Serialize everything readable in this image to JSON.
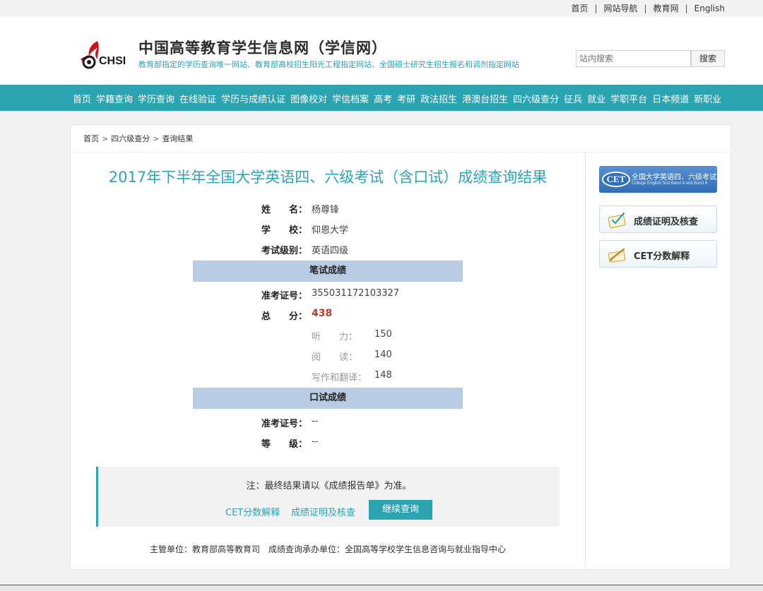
{
  "topnav": {
    "items": [
      "首页",
      "网站导航",
      "教育网",
      "English"
    ],
    "separator": "|"
  },
  "header": {
    "logo_text": "CHSI",
    "title": "中国高等教育学生信息网（学信网）",
    "subtitle": "教育部指定的学历查询唯一网站、教育部高校招生阳光工程指定网站、全国硕士研究生招生报名和调剂指定网站",
    "search_placeholder": "站内搜索",
    "search_button": "搜索"
  },
  "nav": {
    "items": [
      "首页",
      "学籍查询",
      "学历查询",
      "在线验证",
      "学历与成绩认证",
      "图像校对",
      "学信档案",
      "高考",
      "考研",
      "政法招生",
      "港澳台招生",
      "四六级查分",
      "征兵",
      "就业",
      "学职平台",
      "日本频道",
      "新职业"
    ]
  },
  "breadcrumb": {
    "items": [
      "首页",
      "四六级查分",
      "查询结果"
    ],
    "separator": ">"
  },
  "result": {
    "title": "2017年下半年全国大学英语四、六级考试（含口试）成绩查询结果",
    "name_label": "姓　　名：",
    "name": "杨尊锋",
    "school_label": "学　　校：",
    "school": "仰恩大学",
    "level_label": "考试级别：",
    "level": "英语四级",
    "written_header": "笔试成绩",
    "ticket_label": "准考证号：",
    "ticket": "355031172103327",
    "total_label": "总　　分：",
    "total": "438",
    "listening_label": "听　　力：",
    "listening": "150",
    "reading_label": "阅　　读：",
    "reading": "140",
    "writing_label": "写作和翻译：",
    "writing": "148",
    "oral_header": "口试成绩",
    "oral_ticket_label": "准考证号：",
    "oral_ticket": "--",
    "oral_grade_label": "等　　级：",
    "oral_grade": "--"
  },
  "note": {
    "text": "注：最终结果请以《成绩报告单》为准。",
    "link_cet": "CET分数解释",
    "link_cert": "成绩证明及核查",
    "continue_button": "继续查询"
  },
  "footer": {
    "text": "主管单位：教育部高等教育司　成绩查询承办单位：全国高等学校学生信息咨询与就业指导中心"
  },
  "sidebar": {
    "cet_logo": "CET",
    "cet_cn": "全国大学英语四、六级考试",
    "cet_en": "College English Test Band 4 and Band 6",
    "btn_cert": "成绩证明及核查",
    "btn_explain": "CET分数解释"
  },
  "colors": {
    "accent": "#2aa4b0",
    "title": "#2aa4b8",
    "section_header": "#b8cde3",
    "total_score": "#c0392b"
  }
}
